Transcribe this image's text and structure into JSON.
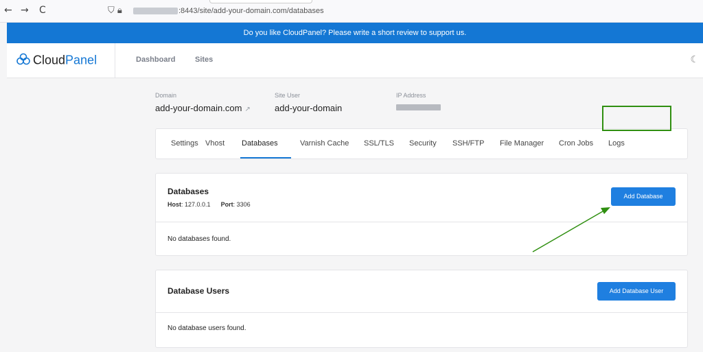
{
  "browser": {
    "back": "←",
    "forward": "→",
    "reload": "C",
    "url_suffix": ":8443/site/add-your-domain.com/databases"
  },
  "promo": {
    "text": "Do you like CloudPanel? Please write a short review to support us."
  },
  "header": {
    "logo_part1": "Cloud",
    "logo_part2": "Panel",
    "nav": {
      "dashboard": "Dashboard",
      "sites": "Sites"
    }
  },
  "site_info": {
    "domain_label": "Domain",
    "domain_value": "add-your-domain.com",
    "site_user_label": "Site User",
    "site_user_value": "add-your-domain",
    "ip_label": "IP Address"
  },
  "tabs": [
    "Settings",
    "Vhost",
    "Databases",
    "Varnish Cache",
    "SSL/TLS",
    "Security",
    "SSH/FTP",
    "File Manager",
    "Cron Jobs",
    "Logs"
  ],
  "active_tab": "Databases",
  "databases": {
    "title": "Databases",
    "host_label": "Host",
    "host_value": "127.0.0.1",
    "port_label": "Port",
    "port_value": "3306",
    "empty_text": "No databases found.",
    "add_button": "Add Database"
  },
  "database_users": {
    "title": "Database Users",
    "empty_text": "No database users found.",
    "add_button": "Add Database User"
  },
  "colors": {
    "accent": "#1477d4",
    "button": "#1f7fe0",
    "annotation": "#2f8f10"
  }
}
